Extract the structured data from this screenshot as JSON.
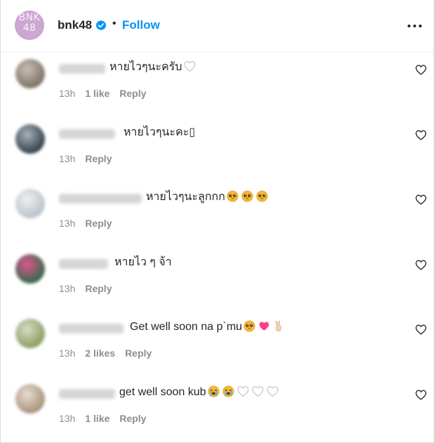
{
  "header": {
    "logo_text": "BNK 48",
    "username": "bnk48",
    "separator": "•",
    "follow_label": "Follow"
  },
  "comments": [
    {
      "text": "หายไวๆนะครับ",
      "time": "13h",
      "likes": "1 like",
      "reply": "Reply",
      "emoji": [
        "white-heart"
      ]
    },
    {
      "text": "หายไวๆนะคะ▯",
      "time": "13h",
      "likes": "",
      "reply": "Reply",
      "emoji": []
    },
    {
      "text": "หายไวๆนะลูกกก",
      "time": "13h",
      "likes": "",
      "reply": "Reply",
      "emoji": [
        "pleading-face",
        "pleading-face",
        "pleading-face"
      ]
    },
    {
      "text": "หายไว ๆ จ้า",
      "time": "13h",
      "likes": "",
      "reply": "Reply",
      "emoji": []
    },
    {
      "text": "Get well soon na p`mu",
      "time": "13h",
      "likes": "2 likes",
      "reply": "Reply",
      "emoji": [
        "pleading-face",
        "sparkling-heart",
        "victory-hand"
      ]
    },
    {
      "text": "get well soon kub",
      "time": "13h",
      "likes": "1 like",
      "reply": "Reply",
      "emoji": [
        "crying-face",
        "crying-face",
        "white-heart",
        "white-heart",
        "white-heart"
      ]
    }
  ],
  "colors": {
    "accent": "#0095f6",
    "text": "#262626",
    "muted": "#8e8e8e",
    "logo_bg": "#cba7d1"
  }
}
